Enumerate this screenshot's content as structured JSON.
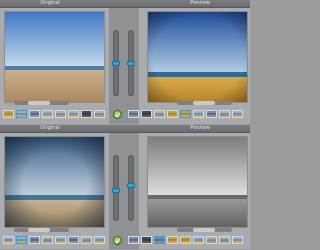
{
  "panels": [
    {
      "left_tab": "Original",
      "right_tab": "Preview"
    },
    {
      "left_tab": "Original",
      "right_tab": "Preview"
    }
  ],
  "presets": {
    "top_left": "warm-original",
    "top_right": "golden-sunset",
    "bottom_left": "vignette-cool",
    "bottom_right": "black-and-white"
  },
  "sliders": {
    "top_left_level": 0.52,
    "top_right_level": 0.52,
    "bottom_left_level": 0.48,
    "bottom_right_level": 0.55
  },
  "colors": {
    "accent": "#2aa7e0",
    "confirm": "#6aad24"
  },
  "icons": [
    "check-icon"
  ]
}
